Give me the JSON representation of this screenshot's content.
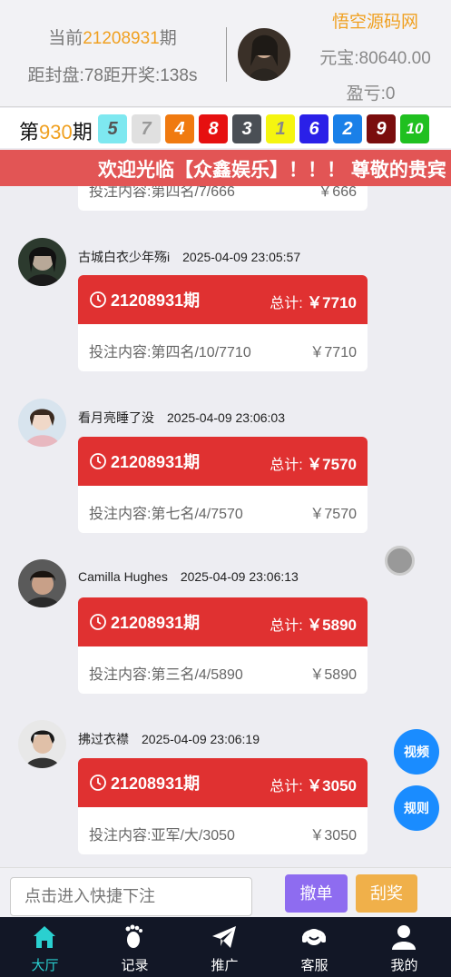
{
  "header": {
    "period_prefix": "当前",
    "period_number": "21208931",
    "period_suffix": "期",
    "countdown": "距封盘:78距开奖:138s",
    "brand": "悟空源码网",
    "yuanbao": "元宝:80640.00",
    "profit": "盈亏:0"
  },
  "result": {
    "prefix": "第",
    "number": "930",
    "suffix": "期",
    "balls": [
      {
        "value": "5",
        "color": "#7ee8f0",
        "text_color": "#555"
      },
      {
        "value": "7",
        "color": "#e0e0e0",
        "text_color": "#999"
      },
      {
        "value": "4",
        "color": "#f07a10",
        "text_color": "#fff"
      },
      {
        "value": "8",
        "color": "#e61010",
        "text_color": "#fff"
      },
      {
        "value": "3",
        "color": "#4a4f55",
        "text_color": "#fff"
      },
      {
        "value": "1",
        "color": "#f5f510",
        "text_color": "#888"
      },
      {
        "value": "6",
        "color": "#2a20e8",
        "text_color": "#fff"
      },
      {
        "value": "2",
        "color": "#1a80e8",
        "text_color": "#fff"
      },
      {
        "value": "9",
        "color": "#7a0d0d",
        "text_color": "#fff"
      },
      {
        "value": "10",
        "color": "#20c020",
        "text_color": "#fff"
      }
    ]
  },
  "marquee": "欢迎光临【众鑫娱乐】！！！ 尊敬的贵宾",
  "feed": {
    "partial_top": {
      "content": "投注内容:第四名/7/666",
      "amount": "￥666"
    },
    "messages": [
      {
        "user": "古城白衣少年殇i",
        "time": "2025-04-09 23:05:57",
        "period": "21208931期",
        "total_label": "总计:",
        "total": "￥7710",
        "content": "投注内容:第四名/10/7710",
        "amount": "￥7710"
      },
      {
        "user": "看月亮睡了没",
        "time": "2025-04-09 23:06:03",
        "period": "21208931期",
        "total_label": "总计:",
        "total": "￥7570",
        "content": "投注内容:第七名/4/7570",
        "amount": "￥7570"
      },
      {
        "user": "Camilla Hughes",
        "time": "2025-04-09 23:06:13",
        "period": "21208931期",
        "total_label": "总计:",
        "total": "￥5890",
        "content": "投注内容:第三名/4/5890",
        "amount": "￥5890"
      },
      {
        "user": "拂过衣襟",
        "time": "2025-04-09 23:06:19",
        "period": "21208931期",
        "total_label": "总计:",
        "total": "￥3050",
        "content": "投注内容:亚军/大/3050",
        "amount": "￥3050"
      }
    ]
  },
  "side_buttons": {
    "video": "视频",
    "rules": "规则"
  },
  "input_bar": {
    "placeholder": "点击进入快捷下注",
    "cancel": "撤单",
    "scratch": "刮奖"
  },
  "tabs": [
    {
      "label": "大厅",
      "icon": "home-icon",
      "active": true
    },
    {
      "label": "记录",
      "icon": "footprint-icon",
      "active": false
    },
    {
      "label": "推广",
      "icon": "paper-plane-icon",
      "active": false
    },
    {
      "label": "客服",
      "icon": "headset-icon",
      "active": false
    },
    {
      "label": "我的",
      "icon": "user-icon",
      "active": false
    }
  ]
}
